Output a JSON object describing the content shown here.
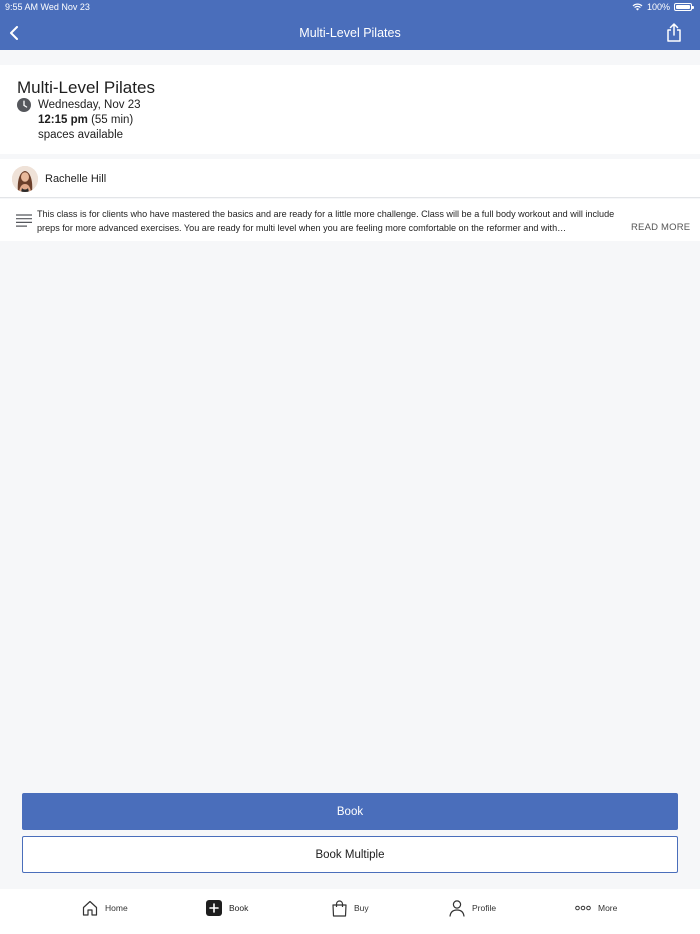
{
  "status_bar": {
    "time": "9:55 AM  Wed Nov 23",
    "battery": "100%",
    "battery_level": 1.0
  },
  "nav": {
    "title": "Multi-Level Pilates",
    "back_icon": "chevron-left-icon",
    "share_icon": "share-icon"
  },
  "class": {
    "title": "Multi-Level Pilates",
    "date": "Wednesday, Nov 23",
    "time": "12:15 pm",
    "duration": "(55 min)",
    "spaces": "spaces available"
  },
  "instructor": {
    "name": "Rachelle Hill"
  },
  "description": {
    "text": "This class is for clients who have mastered the basics and are ready for a little more challenge. Class will be a full body workout and will include preps for more advanced exercises. You are ready for multi level when you are feeling more comfortable on the reformer and with…",
    "read_more": "READ MORE"
  },
  "actions": {
    "book": "Book",
    "book_multiple": "Book Multiple"
  },
  "tabbar": {
    "home": "Home",
    "book": "Book",
    "buy": "Buy",
    "profile": "Profile",
    "more": "More"
  },
  "colors": {
    "brand": "#4a6ebb",
    "background": "#f6f7f9"
  }
}
